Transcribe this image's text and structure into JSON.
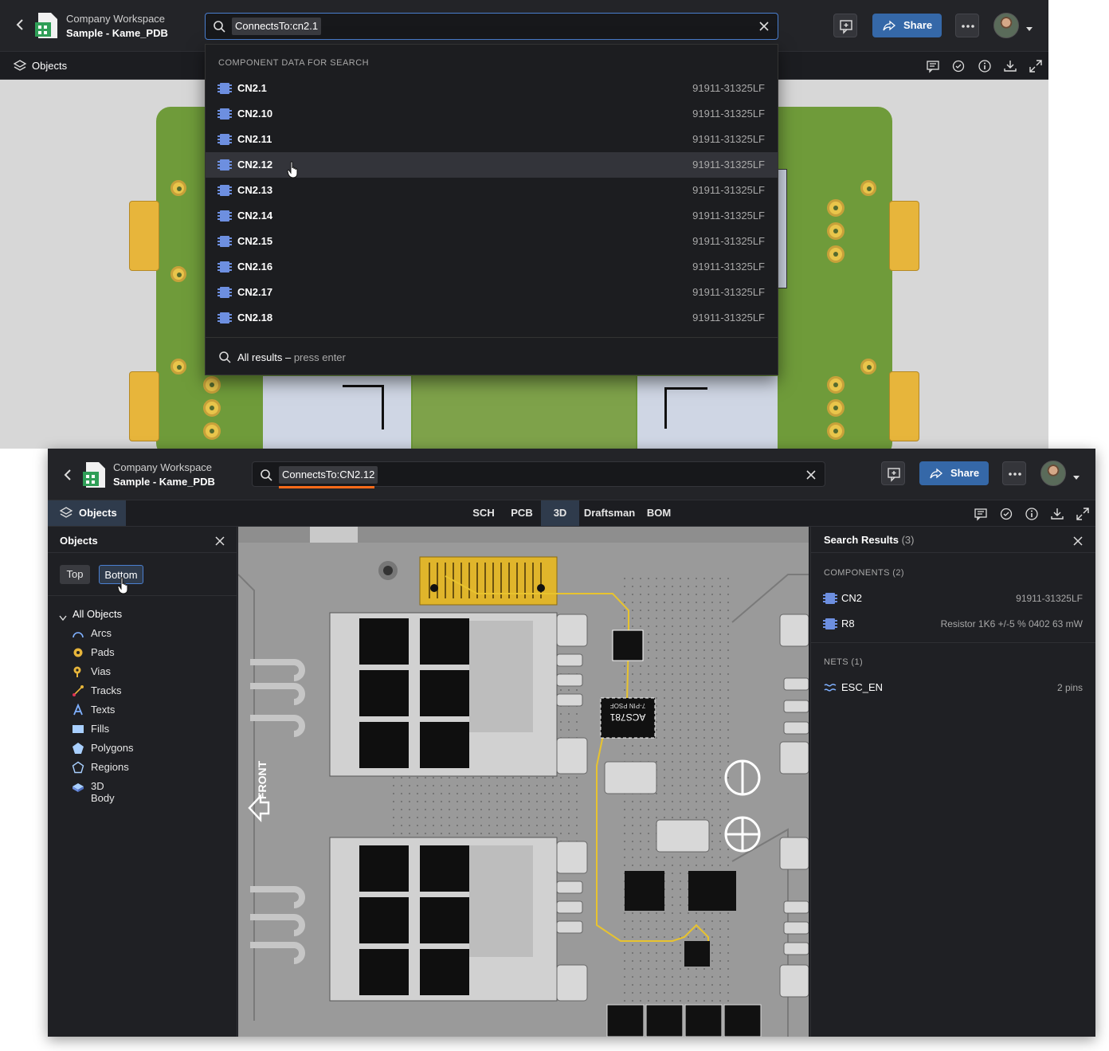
{
  "window1": {
    "workspace": "Company Workspace",
    "project": "Sample - Kame_PDB",
    "search_query": "ConnectsTo:cn2.1",
    "share_label": "Share",
    "objects_label": "Objects",
    "dropdown": {
      "header": "COMPONENT DATA FOR SEARCH",
      "items": [
        {
          "name": "CN2.1",
          "part": "91911-31325LF"
        },
        {
          "name": "CN2.10",
          "part": "91911-31325LF"
        },
        {
          "name": "CN2.11",
          "part": "91911-31325LF"
        },
        {
          "name": "CN2.12",
          "part": "91911-31325LF"
        },
        {
          "name": "CN2.13",
          "part": "91911-31325LF"
        },
        {
          "name": "CN2.14",
          "part": "91911-31325LF"
        },
        {
          "name": "CN2.15",
          "part": "91911-31325LF"
        },
        {
          "name": "CN2.16",
          "part": "91911-31325LF"
        },
        {
          "name": "CN2.17",
          "part": "91911-31325LF"
        },
        {
          "name": "CN2.18",
          "part": "91911-31325LF"
        }
      ],
      "hovered_index": 3,
      "all_results": "All results –",
      "press_enter": "press enter"
    }
  },
  "window2": {
    "workspace": "Company Workspace",
    "project": "Sample - Kame_PDB",
    "search_query": "ConnectsTo:CN2.12",
    "share_label": "Share",
    "objects_tab": "Objects",
    "view_tabs": [
      "SCH",
      "PCB",
      "3D",
      "Draftsman",
      "BOM"
    ],
    "active_view_tab": "3D",
    "objects_panel": {
      "title": "Objects",
      "side_top": "Top",
      "side_bottom": "Bottom",
      "all_objects": "All Objects",
      "items": [
        "Arcs",
        "Pads",
        "Vias",
        "Tracks",
        "Texts",
        "Fills",
        "Polygons",
        "Regions",
        "3D Body"
      ]
    },
    "board_labels": {
      "front": "FRONT",
      "chip_mark": "ACS781",
      "chip_sub": "7-PIN PSOF"
    },
    "search_results": {
      "title": "Search Results",
      "count": "(3)",
      "components_header": "COMPONENTS (2)",
      "components": [
        {
          "name": "CN2",
          "detail": "91911-31325LF"
        },
        {
          "name": "R8",
          "detail": "Resistor 1K6 +/-5 % 0402 63 mW"
        }
      ],
      "nets_header": "NETS (1)",
      "nets": [
        {
          "name": "ESC_EN",
          "detail": "2 pins"
        }
      ]
    }
  },
  "colors": {
    "accent_blue": "#3568a8",
    "underline_orange": "#ff6b1a",
    "trace_yellow": "#e8c32e"
  }
}
